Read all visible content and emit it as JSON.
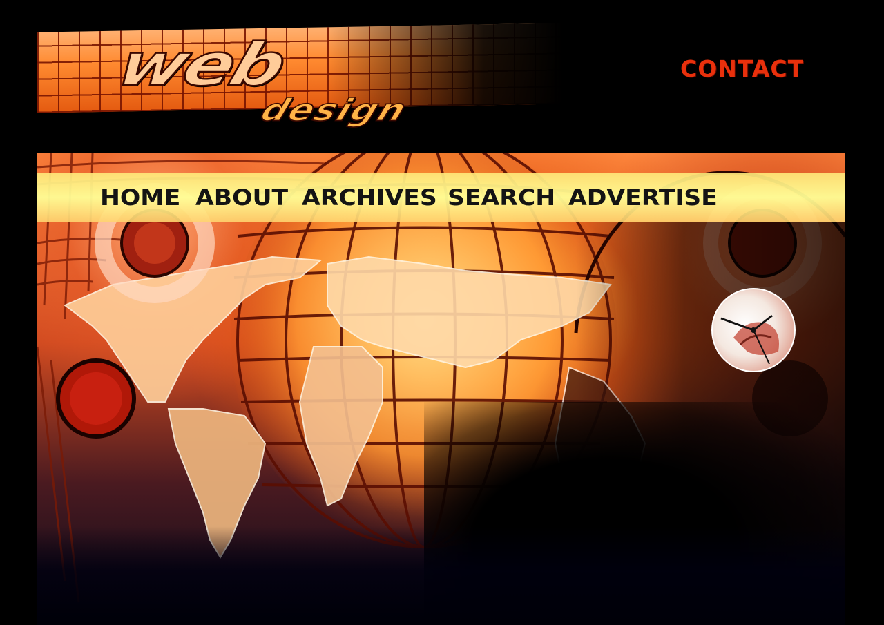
{
  "header": {
    "logo": {
      "word_primary": "web",
      "word_secondary": "design"
    },
    "contact_label": "CONTACT"
  },
  "nav": {
    "items": [
      {
        "label": "HOME"
      },
      {
        "label": "ABOUT"
      },
      {
        "label": "ARCHIVES"
      },
      {
        "label": "SEARCH"
      },
      {
        "label": "ADVERTISE"
      }
    ]
  },
  "hero": {
    "image": "world-map-globe-illustration",
    "icon": "clock-icon"
  },
  "colors": {
    "background": "#000000",
    "contact": "#e8300c",
    "nav_bar": "#ffff99",
    "nav_text": "#141414",
    "accent_orange": "#ff8a30"
  }
}
